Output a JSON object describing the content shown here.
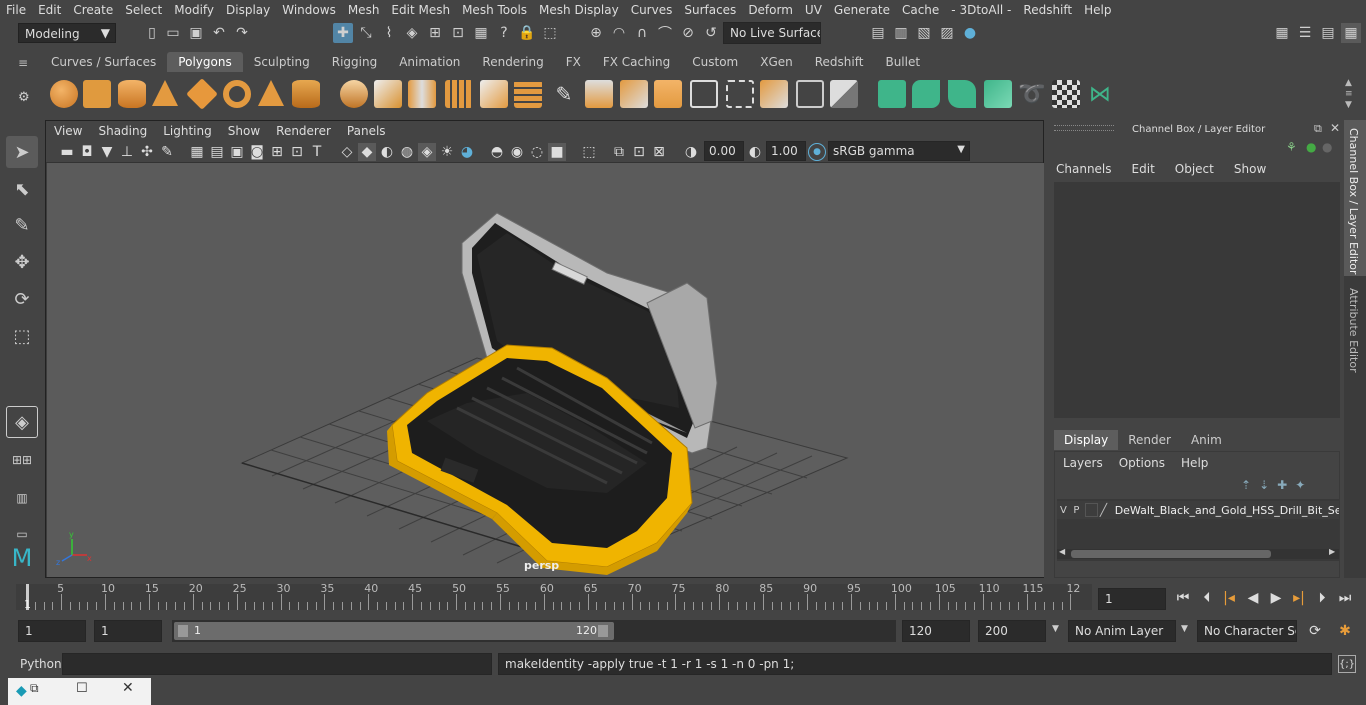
{
  "menu": [
    "File",
    "Edit",
    "Create",
    "Select",
    "Modify",
    "Display",
    "Windows",
    "Mesh",
    "Edit Mesh",
    "Mesh Tools",
    "Mesh Display",
    "Curves",
    "Surfaces",
    "Deform",
    "UV",
    "Generate",
    "Cache",
    "- 3DtoAll -",
    "Redshift",
    "Help"
  ],
  "status": {
    "mode": "Modeling",
    "live_surface": "No Live Surface"
  },
  "shelf": {
    "tabs": [
      "Curves / Surfaces",
      "Polygons",
      "Sculpting",
      "Rigging",
      "Animation",
      "Rendering",
      "FX",
      "FX Caching",
      "Custom",
      "XGen",
      "Redshift",
      "Bullet"
    ],
    "active_tab": "Polygons"
  },
  "viewport": {
    "menu": [
      "View",
      "Shading",
      "Lighting",
      "Show",
      "Renderer",
      "Panels"
    ],
    "exposure": "0.00",
    "gamma": "1.00",
    "color_space": "sRGB gamma",
    "camera_label": "persp"
  },
  "channel_box": {
    "title": "Channel Box / Layer Editor",
    "menu": [
      "Channels",
      "Edit",
      "Object",
      "Show"
    ]
  },
  "layer_editor": {
    "tabs": [
      "Display",
      "Render",
      "Anim"
    ],
    "active_tab": "Display",
    "menu": [
      "Layers",
      "Options",
      "Help"
    ],
    "layer": {
      "v": "V",
      "p": "P",
      "name": "DeWalt_Black_and_Gold_HSS_Drill_Bit_Set_v"
    }
  },
  "side_tabs": [
    "Channel Box / Layer Editor",
    "Attribute Editor"
  ],
  "timeline": {
    "ticks": [
      "5",
      "10",
      "15",
      "20",
      "25",
      "30",
      "35",
      "40",
      "45",
      "50",
      "55",
      "60",
      "65",
      "70",
      "75",
      "80",
      "85",
      "90",
      "95",
      "100",
      "105",
      "110",
      "115",
      "12"
    ],
    "start_label": "1",
    "current_frame": "1"
  },
  "range": {
    "start": "1",
    "playback_start": "1",
    "slider_start": "1",
    "slider_end": "120",
    "playback_end": "120",
    "end": "200",
    "anim_layer": "No Anim Layer",
    "char_set": "No Character Set"
  },
  "cmdline": {
    "language": "Python",
    "feedback": "makeIdentity -apply true -t 1 -r 1 -s 1 -n 0 -pn 1;"
  },
  "colors": {
    "accent_blue": "#5285a6",
    "case_yellow": "#f0b400",
    "lid_gray": "#b8b8b8",
    "shelf_green": "#3fb58a",
    "shelf_orange": "#e79c3a"
  }
}
